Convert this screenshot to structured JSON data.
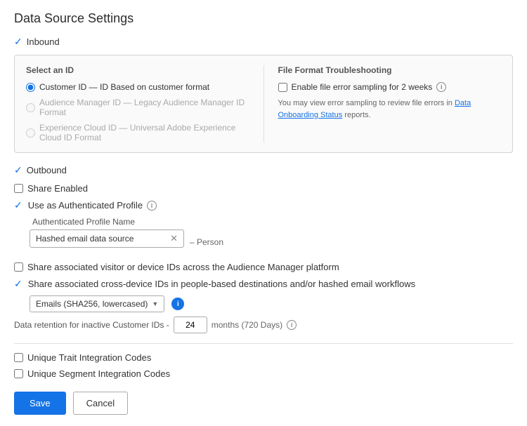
{
  "page": {
    "title": "Data Source Settings"
  },
  "inbound": {
    "label": "Inbound",
    "select_id": {
      "label": "Select an ID",
      "options": [
        {
          "label": "Customer ID — ID Based on customer format",
          "checked": true,
          "disabled": false
        },
        {
          "label": "Audience Manager ID — Legacy Audience Manager ID Format",
          "checked": false,
          "disabled": true
        },
        {
          "label": "Experience Cloud ID — Universal Adobe Experience Cloud ID Format",
          "checked": false,
          "disabled": true
        }
      ]
    },
    "file_format": {
      "label": "File Format Troubleshooting",
      "enable_sampling_label": "Enable file error sampling for 2 weeks",
      "note": "You may view error sampling to review file errors in ",
      "link_text": "Data Onboarding Status",
      "note_suffix": " reports."
    }
  },
  "outbound": {
    "label": "Outbound",
    "share_enabled": {
      "label": "Share Enabled",
      "checked": false
    },
    "use_as_auth": {
      "label": "Use as Authenticated Profile",
      "checked": true
    },
    "auth_profile_name": {
      "label": "Authenticated Profile Name",
      "value": "Hashed email data source",
      "suffix": "– Person"
    },
    "share_visitor": {
      "label": "Share associated visitor or device IDs across the Audience Manager platform",
      "checked": false
    },
    "share_cross_device": {
      "label": "Share associated cross-device IDs in people-based destinations and/or hashed email workflows",
      "checked": true
    },
    "dropdown": {
      "value": "Emails (SHA256, lowercased)",
      "options": [
        "Emails (SHA256, lowercased)"
      ]
    },
    "retention": {
      "label_prefix": "Data retention for inactive Customer IDs -",
      "value": "24",
      "label_suffix": "months (720 Days)"
    }
  },
  "integration": {
    "unique_trait": {
      "label": "Unique Trait Integration Codes",
      "checked": false
    },
    "unique_segment": {
      "label": "Unique Segment Integration Codes",
      "checked": false
    }
  },
  "footer": {
    "save_label": "Save",
    "cancel_label": "Cancel"
  }
}
